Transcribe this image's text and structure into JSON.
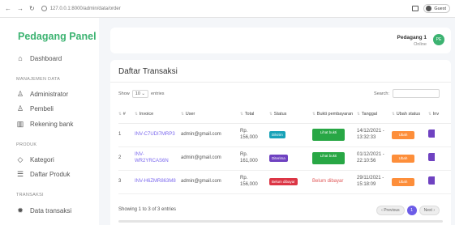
{
  "browser": {
    "url": "127.0.0.1:8000/admin/data/order",
    "profile": "Guest"
  },
  "sidebar": {
    "brand": "Pedagang Panel",
    "dashboard": "Dashboard",
    "section_manajemen": "MANAJEMEN DATA",
    "administrator": "Administrator",
    "pembeli": "Pembeli",
    "rekening": "Rekening bank",
    "section_produk": "PRODUK",
    "kategori": "Kategori",
    "daftar_produk": "Daftar Produk",
    "section_transaksi": "TRANSAKSI",
    "data_transaksi": "Data transaksi"
  },
  "topbar": {
    "user_name": "Pedagang 1",
    "user_status": "Online",
    "avatar_initials": "PE",
    "accent": "#3cb371"
  },
  "card": {
    "title": "Daftar Transaksi",
    "show_label": "Show",
    "show_value": "10",
    "entries_label": "entries",
    "search_label": "Search:"
  },
  "table": {
    "headers": [
      "#",
      "Invoice",
      "User",
      "Total",
      "Status",
      "Bukti pembayaran",
      "Tanggal",
      "Ubah status",
      "Inv"
    ],
    "rows": [
      {
        "no": "1",
        "invoice": "INV-C7UDI7MRP3",
        "user": "admin@gmail.com",
        "total": "Rp. 156,000",
        "status": "Dikirim",
        "status_color": "#17a2b8",
        "bukti": "Lihat bukti",
        "tanggal": "14/12/2021 - 13:32:33",
        "ubah": "Ubah"
      },
      {
        "no": "2",
        "invoice": "INV-WR2YRCAS6N",
        "user": "admin@gmail.com",
        "total": "Rp. 161,000",
        "status": "Diterima",
        "status_color": "#6f42c1",
        "bukti": "Lihat bukti",
        "tanggal": "01/12/2021 - 22:10:56",
        "ubah": "Ubah"
      },
      {
        "no": "3",
        "invoice": "INV-H6ZMR863M8",
        "user": "admin@gmail.com",
        "total": "Rp. 156,000",
        "status": "Belum dibayar",
        "status_color": "#dc3545",
        "bukti": "Belum dibayar",
        "tanggal": "29/11/2021 - 15:18:09",
        "ubah": "Ubah"
      }
    ]
  },
  "footer": {
    "info": "Showing 1 to 3 of 3 entries",
    "previous": "‹ Previous",
    "page": "1",
    "next": "Next ›"
  }
}
